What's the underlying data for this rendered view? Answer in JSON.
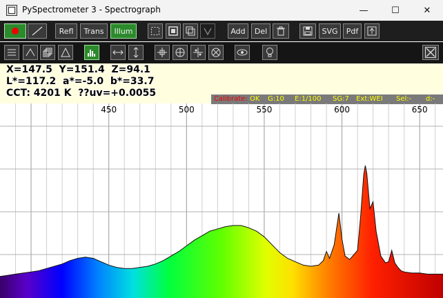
{
  "window": {
    "title": "PySpectrometer 3 - Spectrograph",
    "minimize": "—",
    "maximize": "☐",
    "close": "✕"
  },
  "toolbar1": {
    "refl_label": "Refl",
    "trans_label": "Trans",
    "illum_label": "Illum",
    "add_label": "Add",
    "del_label": "Del",
    "svg_label": "SVG",
    "pdf_label": "Pdf"
  },
  "readout": {
    "line1": "X=147.5  Y=151.4  Z=94.1",
    "line2": "L*=117.2  a*=-5.0  b*=33.7",
    "line3": "CCT: 4201 K  ??uv=+0.0055"
  },
  "status": {
    "calibrate": "Calibrate:",
    "calibrate_value": "OK",
    "gain": "G:10",
    "exposure": "E:1/100",
    "sg": "SG:7",
    "ext": "Ext:WEI",
    "sel": "Sel:-",
    "d": "d:-"
  },
  "chart_data": {
    "type": "area",
    "xlabel": "",
    "ylabel": "",
    "xlim": [
      380,
      665
    ],
    "ylim": [
      0,
      1
    ],
    "x_ticks": [
      450,
      500,
      550,
      600,
      650
    ],
    "grid": true,
    "fill": "wavelength-colored spectrum gradient",
    "x": [
      380,
      385,
      390,
      395,
      400,
      405,
      410,
      415,
      420,
      425,
      430,
      435,
      440,
      445,
      450,
      455,
      460,
      465,
      470,
      475,
      480,
      485,
      490,
      495,
      500,
      505,
      510,
      515,
      520,
      525,
      530,
      535,
      540,
      545,
      550,
      555,
      560,
      565,
      570,
      575,
      580,
      585,
      588,
      590,
      592,
      595,
      598,
      600,
      602,
      605,
      610,
      612,
      614,
      615,
      616,
      618,
      620,
      622,
      625,
      628,
      630,
      632,
      634,
      636,
      638,
      640,
      645,
      650,
      655,
      660,
      665
    ],
    "y": [
      0.02,
      0.03,
      0.04,
      0.05,
      0.06,
      0.07,
      0.09,
      0.11,
      0.13,
      0.16,
      0.18,
      0.19,
      0.18,
      0.15,
      0.12,
      0.1,
      0.09,
      0.09,
      0.1,
      0.11,
      0.13,
      0.16,
      0.2,
      0.24,
      0.29,
      0.34,
      0.38,
      0.42,
      0.44,
      0.46,
      0.47,
      0.47,
      0.45,
      0.42,
      0.37,
      0.3,
      0.23,
      0.18,
      0.15,
      0.12,
      0.11,
      0.12,
      0.16,
      0.24,
      0.18,
      0.3,
      0.58,
      0.35,
      0.2,
      0.17,
      0.25,
      0.55,
      0.92,
      1.0,
      0.93,
      0.62,
      0.68,
      0.42,
      0.2,
      0.14,
      0.15,
      0.25,
      0.14,
      0.1,
      0.07,
      0.06,
      0.05,
      0.05,
      0.04,
      0.04,
      0.04
    ]
  }
}
